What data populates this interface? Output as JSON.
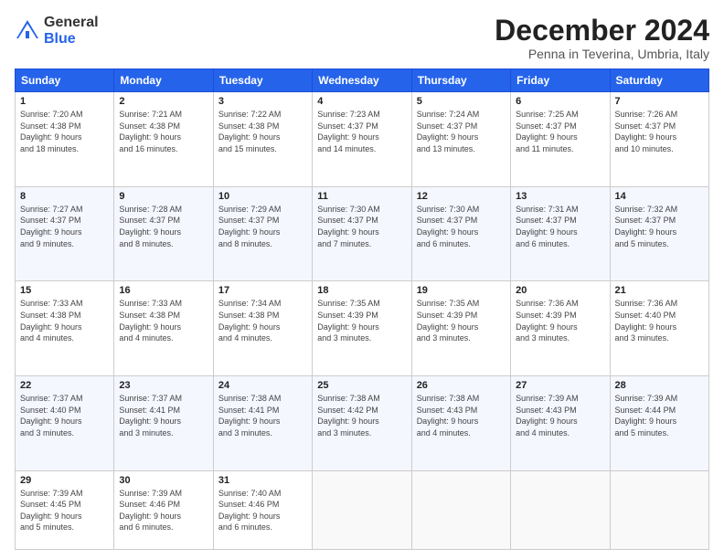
{
  "header": {
    "logo_general": "General",
    "logo_blue": "Blue",
    "title": "December 2024",
    "location": "Penna in Teverina, Umbria, Italy"
  },
  "days_of_week": [
    "Sunday",
    "Monday",
    "Tuesday",
    "Wednesday",
    "Thursday",
    "Friday",
    "Saturday"
  ],
  "weeks": [
    [
      {
        "day": "1",
        "info": "Sunrise: 7:20 AM\nSunset: 4:38 PM\nDaylight: 9 hours\nand 18 minutes."
      },
      {
        "day": "2",
        "info": "Sunrise: 7:21 AM\nSunset: 4:38 PM\nDaylight: 9 hours\nand 16 minutes."
      },
      {
        "day": "3",
        "info": "Sunrise: 7:22 AM\nSunset: 4:38 PM\nDaylight: 9 hours\nand 15 minutes."
      },
      {
        "day": "4",
        "info": "Sunrise: 7:23 AM\nSunset: 4:37 PM\nDaylight: 9 hours\nand 14 minutes."
      },
      {
        "day": "5",
        "info": "Sunrise: 7:24 AM\nSunset: 4:37 PM\nDaylight: 9 hours\nand 13 minutes."
      },
      {
        "day": "6",
        "info": "Sunrise: 7:25 AM\nSunset: 4:37 PM\nDaylight: 9 hours\nand 11 minutes."
      },
      {
        "day": "7",
        "info": "Sunrise: 7:26 AM\nSunset: 4:37 PM\nDaylight: 9 hours\nand 10 minutes."
      }
    ],
    [
      {
        "day": "8",
        "info": "Sunrise: 7:27 AM\nSunset: 4:37 PM\nDaylight: 9 hours\nand 9 minutes."
      },
      {
        "day": "9",
        "info": "Sunrise: 7:28 AM\nSunset: 4:37 PM\nDaylight: 9 hours\nand 8 minutes."
      },
      {
        "day": "10",
        "info": "Sunrise: 7:29 AM\nSunset: 4:37 PM\nDaylight: 9 hours\nand 8 minutes."
      },
      {
        "day": "11",
        "info": "Sunrise: 7:30 AM\nSunset: 4:37 PM\nDaylight: 9 hours\nand 7 minutes."
      },
      {
        "day": "12",
        "info": "Sunrise: 7:30 AM\nSunset: 4:37 PM\nDaylight: 9 hours\nand 6 minutes."
      },
      {
        "day": "13",
        "info": "Sunrise: 7:31 AM\nSunset: 4:37 PM\nDaylight: 9 hours\nand 6 minutes."
      },
      {
        "day": "14",
        "info": "Sunrise: 7:32 AM\nSunset: 4:37 PM\nDaylight: 9 hours\nand 5 minutes."
      }
    ],
    [
      {
        "day": "15",
        "info": "Sunrise: 7:33 AM\nSunset: 4:38 PM\nDaylight: 9 hours\nand 4 minutes."
      },
      {
        "day": "16",
        "info": "Sunrise: 7:33 AM\nSunset: 4:38 PM\nDaylight: 9 hours\nand 4 minutes."
      },
      {
        "day": "17",
        "info": "Sunrise: 7:34 AM\nSunset: 4:38 PM\nDaylight: 9 hours\nand 4 minutes."
      },
      {
        "day": "18",
        "info": "Sunrise: 7:35 AM\nSunset: 4:39 PM\nDaylight: 9 hours\nand 3 minutes."
      },
      {
        "day": "19",
        "info": "Sunrise: 7:35 AM\nSunset: 4:39 PM\nDaylight: 9 hours\nand 3 minutes."
      },
      {
        "day": "20",
        "info": "Sunrise: 7:36 AM\nSunset: 4:39 PM\nDaylight: 9 hours\nand 3 minutes."
      },
      {
        "day": "21",
        "info": "Sunrise: 7:36 AM\nSunset: 4:40 PM\nDaylight: 9 hours\nand 3 minutes."
      }
    ],
    [
      {
        "day": "22",
        "info": "Sunrise: 7:37 AM\nSunset: 4:40 PM\nDaylight: 9 hours\nand 3 minutes."
      },
      {
        "day": "23",
        "info": "Sunrise: 7:37 AM\nSunset: 4:41 PM\nDaylight: 9 hours\nand 3 minutes."
      },
      {
        "day": "24",
        "info": "Sunrise: 7:38 AM\nSunset: 4:41 PM\nDaylight: 9 hours\nand 3 minutes."
      },
      {
        "day": "25",
        "info": "Sunrise: 7:38 AM\nSunset: 4:42 PM\nDaylight: 9 hours\nand 3 minutes."
      },
      {
        "day": "26",
        "info": "Sunrise: 7:38 AM\nSunset: 4:43 PM\nDaylight: 9 hours\nand 4 minutes."
      },
      {
        "day": "27",
        "info": "Sunrise: 7:39 AM\nSunset: 4:43 PM\nDaylight: 9 hours\nand 4 minutes."
      },
      {
        "day": "28",
        "info": "Sunrise: 7:39 AM\nSunset: 4:44 PM\nDaylight: 9 hours\nand 5 minutes."
      }
    ],
    [
      {
        "day": "29",
        "info": "Sunrise: 7:39 AM\nSunset: 4:45 PM\nDaylight: 9 hours\nand 5 minutes."
      },
      {
        "day": "30",
        "info": "Sunrise: 7:39 AM\nSunset: 4:46 PM\nDaylight: 9 hours\nand 6 minutes."
      },
      {
        "day": "31",
        "info": "Sunrise: 7:40 AM\nSunset: 4:46 PM\nDaylight: 9 hours\nand 6 minutes."
      },
      {
        "day": "",
        "info": ""
      },
      {
        "day": "",
        "info": ""
      },
      {
        "day": "",
        "info": ""
      },
      {
        "day": "",
        "info": ""
      }
    ]
  ]
}
